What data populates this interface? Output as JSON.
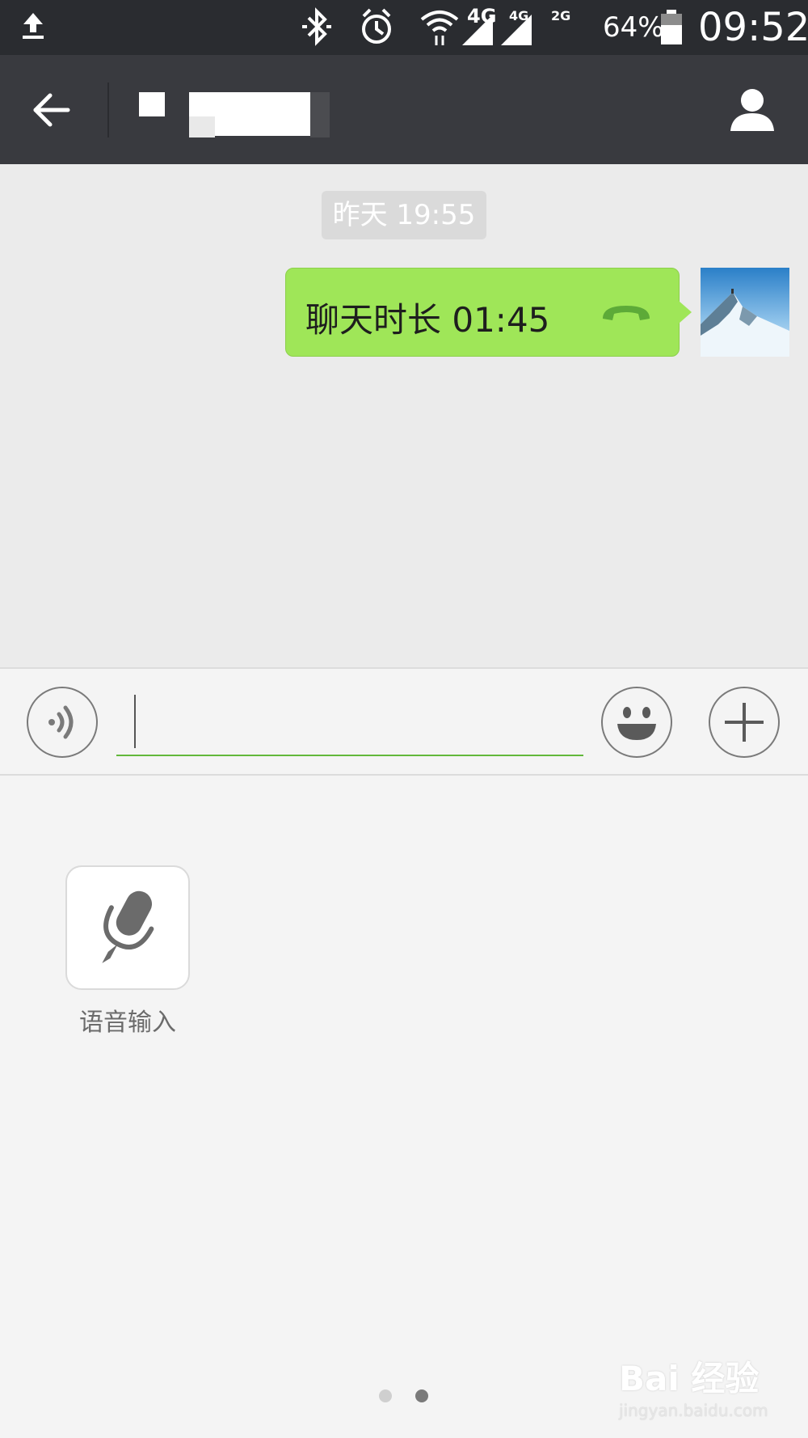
{
  "status_bar": {
    "network_label": "4G",
    "sim1_label": "4G",
    "sim2_label": "2G",
    "battery_percent": "64%",
    "time": "09:52",
    "battery_level": 0.64
  },
  "header": {
    "back_icon": "arrow-left-icon",
    "contact_icon": "person-icon"
  },
  "chat": {
    "timestamp": "昨天 19:55",
    "messages": [
      {
        "from": "me",
        "text": "聊天时长 01:45",
        "icon": "phone-hangup-icon"
      }
    ]
  },
  "input_bar": {
    "value": "",
    "placeholder": ""
  },
  "panel": {
    "tools": [
      {
        "label": "语音输入",
        "icon": "microphone-icon"
      }
    ],
    "page_count": 2,
    "active_page": 2
  },
  "watermark": {
    "main": "Bai 经验",
    "url": "jingyan.baidu.com"
  },
  "colors": {
    "status_bar": "#2a2c30",
    "title_bar": "#393a3f",
    "chat_bg": "#ebebeb",
    "bubble": "#9fe658",
    "input_underline": "#62b83b"
  }
}
